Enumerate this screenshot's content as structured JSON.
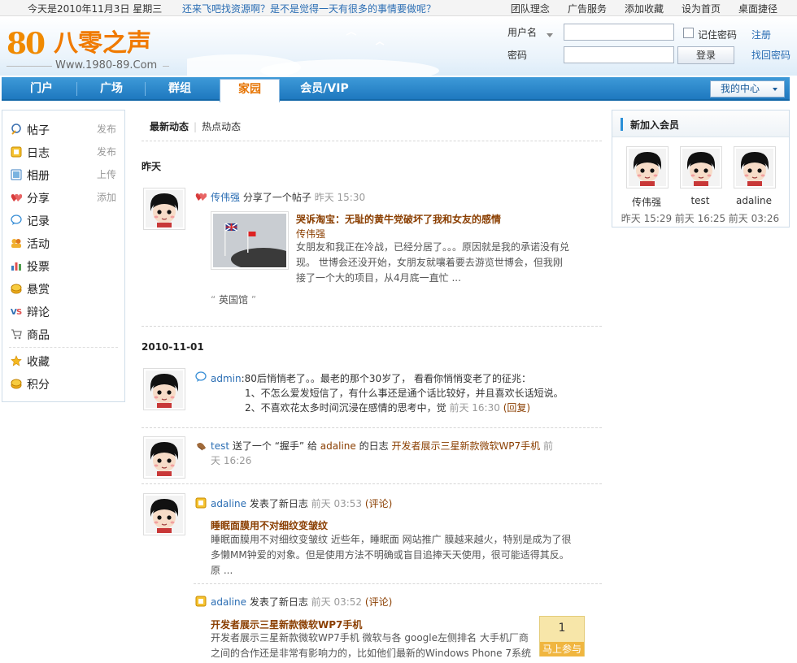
{
  "topbar": {
    "date": "今天是2010年11月3日  星期三",
    "slogan": "还来飞吧找资源啊？是不是觉得一天有很多的事情要做呢？",
    "links": [
      "团队理念",
      "广告服务",
      "添加收藏",
      "设为首页",
      "桌面捷径"
    ]
  },
  "logo": {
    "mark": "80",
    "cn": "八零之声",
    "url": "Www.1980-89.Com"
  },
  "login": {
    "username_label": "用户名",
    "password_label": "密码",
    "username_value": "",
    "password_value": "",
    "remember_label": "记住密码",
    "login_button": "登录",
    "register_link": "注册",
    "recover_link": "找回密码"
  },
  "nav": {
    "tabs": [
      "门户",
      "广场",
      "群组",
      "家园",
      "会员/VIP"
    ],
    "active": "家园",
    "my_center": "我的中心"
  },
  "sidebar": {
    "items": [
      {
        "label": "帖子",
        "action": "发布"
      },
      {
        "label": "日志",
        "action": "发布"
      },
      {
        "label": "相册",
        "action": "上传"
      },
      {
        "label": "分享",
        "action": "添加"
      },
      {
        "label": "记录",
        "action": ""
      },
      {
        "label": "活动",
        "action": ""
      },
      {
        "label": "投票",
        "action": ""
      },
      {
        "label": "悬赏",
        "action": ""
      },
      {
        "label": "辩论",
        "action": ""
      },
      {
        "label": "商品",
        "action": ""
      },
      {
        "label": "收藏",
        "action": ""
      },
      {
        "label": "积分",
        "action": ""
      }
    ]
  },
  "feed": {
    "tabs": [
      "最新动态",
      "热点动态"
    ],
    "day1": "昨天",
    "day2": "2010-11-01",
    "entry1": {
      "user": "传伟强",
      "action": "分享了一个帖子",
      "time": "昨天 15:30",
      "title": "哭诉淘宝：无耻的黄牛党破坏了我和女友的感情",
      "author": "传伟强",
      "text1": "女朋友和我正在冷战，已经分居了。。。原因就是我的承诺没有兑",
      "text2": "现。      世博会还没开始，女朋友就嚷着要去游览世博会，但我刚",
      "text3": "接了一个大的项目，从4月底一直忙 ...",
      "quote": "英国馆"
    },
    "entry2": {
      "user": "admin",
      "text1": "80后悄悄老了。。最老的那个30岁了，      看看你悄悄变老了的征兆：",
      "text2": "1、不怎么爱发短信了，有什么事还是通个话比较好，并且喜欢长话短说。",
      "text3": "2、不喜欢花太多时间沉浸在感情的思考中，觉",
      "time": "前天 16:30",
      "reply": "(回复)"
    },
    "entry3": {
      "user": "test",
      "text_a": "送了一个 “握手” 给",
      "target": "adaline",
      "text_b": "的日志",
      "blog": "开发者展示三星新款微软WP7手机",
      "time_a": "前",
      "time_b": "天 16:26"
    },
    "entry4": {
      "user": "adaline",
      "action": "发表了新日志",
      "time": "前天 03:53",
      "comment": "(评论)",
      "title": "睡眠面膜用不对细纹变皱纹",
      "text1": "睡眠面膜用不对细纹变皱纹  近些年，睡眠面  网站推广  膜越来越火，特别是成为了很",
      "text2": "多懒MM钟爱的对象。但是使用方法不明确或盲目追捧天天使用，很可能适得其反。",
      "text3": "原 ..."
    },
    "entry5": {
      "user": "adaline",
      "action": "发表了新日志",
      "time": "前天 03:52",
      "comment": "(评论)",
      "title": "开发者展示三星新款微软WP7手机",
      "text1": "开发者展示三星新款微软WP7手机  微软与各  google左侧排名  大手机厂商",
      "text2": "之间的合作还是非常有影响力的，比如他们最新的Windows Phone 7系统"
    }
  },
  "new_members": {
    "title": "新加入会员",
    "members": [
      {
        "name": "传伟强",
        "time": "昨天 15:29"
      },
      {
        "name": "test",
        "time": "前天 16:25"
      },
      {
        "name": "adaline",
        "time": "前天 03:26"
      }
    ]
  },
  "join_box": {
    "count": "1",
    "label": "马上参与"
  },
  "colors": {
    "nav_blue": "#1e78bf",
    "accent_orange": "#e67300",
    "link_blue": "#2a6db3",
    "title_brown": "#8a3e00"
  }
}
